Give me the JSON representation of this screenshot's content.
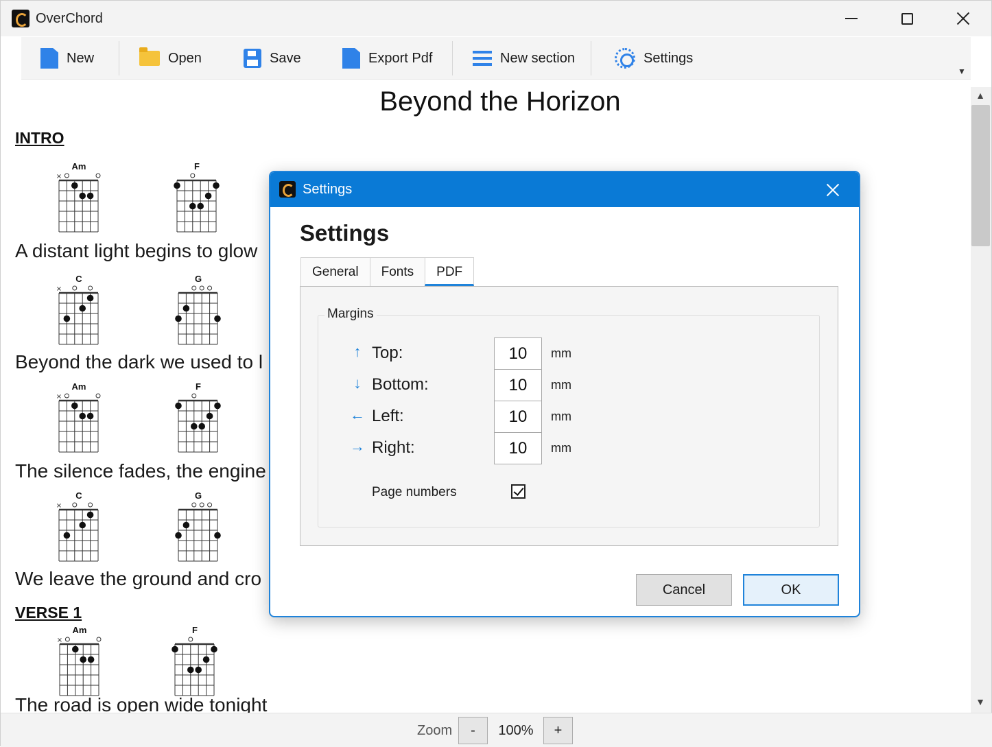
{
  "window": {
    "title": "OverChord"
  },
  "toolbar": {
    "new": "New",
    "open": "Open",
    "save": "Save",
    "export_pdf": "Export Pdf",
    "new_section": "New section",
    "settings": "Settings"
  },
  "song": {
    "title": "Beyond the Horizon",
    "sections": [
      {
        "name": "INTRO"
      },
      {
        "name": "VERSE 1"
      }
    ],
    "lines": [
      {
        "chords": [
          "Am",
          "F"
        ],
        "text": "A distant light begins to glow"
      },
      {
        "chords": [
          "C",
          "G"
        ],
        "text": "Beyond the dark we used to l"
      },
      {
        "chords": [
          "Am",
          "F"
        ],
        "text": "The silence fades, the engine"
      },
      {
        "chords": [
          "C",
          "G"
        ],
        "text": "We leave the ground and cro"
      },
      {
        "chords": [
          "Am",
          "F"
        ],
        "text": "The road is open wide tonight"
      }
    ]
  },
  "statusbar": {
    "zoom_label": "Zoom",
    "zoom_minus": "-",
    "zoom_value": "100%",
    "zoom_plus": "+"
  },
  "dialog": {
    "title": "Settings",
    "heading": "Settings",
    "tabs": [
      {
        "label": "General",
        "active": false
      },
      {
        "label": "Fonts",
        "active": false
      },
      {
        "label": "PDF",
        "active": true
      }
    ],
    "margins_group": "Margins",
    "margins": [
      {
        "label": "Top:",
        "value": "10",
        "unit": "mm",
        "arrow": "↑"
      },
      {
        "label": "Bottom:",
        "value": "10",
        "unit": "mm",
        "arrow": "↓"
      },
      {
        "label": "Left:",
        "value": "10",
        "unit": "mm",
        "arrow": "←"
      },
      {
        "label": "Right:",
        "value": "10",
        "unit": "mm",
        "arrow": "→"
      }
    ],
    "page_numbers_label": "Page numbers",
    "page_numbers_checked": true,
    "cancel": "Cancel",
    "ok": "OK"
  },
  "colors": {
    "accent": "#1f83da",
    "dialog_titlebar": "#0a7ad6",
    "folder": "#f5c33b"
  }
}
